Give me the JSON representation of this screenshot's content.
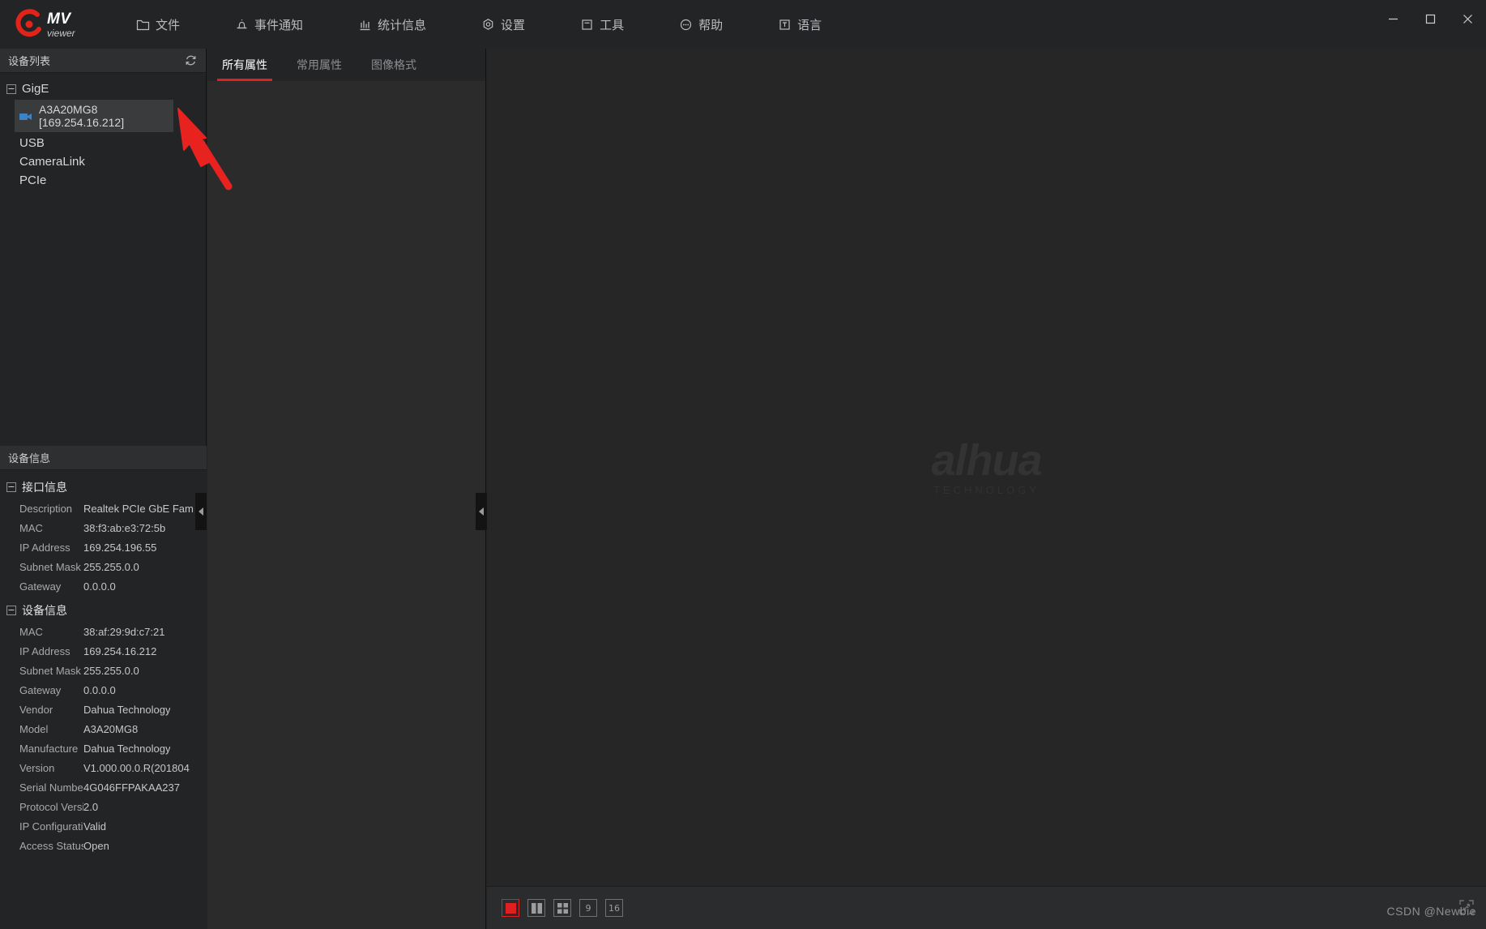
{
  "app": {
    "logo_primary": "MV",
    "logo_secondary": "viewer",
    "accent_color": "#e02020",
    "background_color": "#232425"
  },
  "menu": {
    "items": [
      {
        "label": "文件",
        "icon": "folder-icon"
      },
      {
        "label": "事件通知",
        "icon": "bell-icon"
      },
      {
        "label": "统计信息",
        "icon": "bar-chart-icon"
      },
      {
        "label": "设置",
        "icon": "gear-icon"
      },
      {
        "label": "工具",
        "icon": "toolbox-icon"
      },
      {
        "label": "帮助",
        "icon": "help-icon"
      },
      {
        "label": "语言",
        "icon": "language-icon"
      }
    ]
  },
  "window_controls": {
    "minimize": "—",
    "maximize": "□",
    "close": "✕"
  },
  "sidebar": {
    "title": "设备列表",
    "refresh_icon": "refresh-icon",
    "tree": {
      "group_label": "GigE",
      "group_expander": "−",
      "devices": [
        {
          "label": "A3A20MG8 [169.254.16.212]",
          "selected": true,
          "icon": "camera-icon"
        }
      ],
      "nodes": [
        "USB",
        "CameraLink",
        "PCIe"
      ]
    }
  },
  "device_info": {
    "title": "设备信息",
    "sections": [
      {
        "name": "接口信息",
        "expander": "−",
        "rows": [
          {
            "key": "Description",
            "value": "Realtek PCIe GbE Fam"
          },
          {
            "key": "MAC",
            "value": "38:f3:ab:e3:72:5b"
          },
          {
            "key": "IP Address",
            "value": "169.254.196.55"
          },
          {
            "key": "Subnet Mask",
            "value": "255.255.0.0"
          },
          {
            "key": "Gateway",
            "value": "0.0.0.0"
          }
        ]
      },
      {
        "name": "设备信息",
        "expander": "−",
        "rows": [
          {
            "key": "MAC",
            "value": "38:af:29:9d:c7:21"
          },
          {
            "key": "IP Address",
            "value": "169.254.16.212"
          },
          {
            "key": "Subnet Mask",
            "value": "255.255.0.0"
          },
          {
            "key": "Gateway",
            "value": "0.0.0.0"
          },
          {
            "key": "Vendor",
            "value": "Dahua Technology"
          },
          {
            "key": "Model",
            "value": "A3A20MG8"
          },
          {
            "key": "Manufacture",
            "value": "Dahua Technology"
          },
          {
            "key": "Version",
            "value": "V1.000.00.0.R(201804"
          },
          {
            "key": "Serial Number",
            "value": "4G046FFPAKAA237"
          },
          {
            "key": "Protocol Version",
            "value": "2.0"
          },
          {
            "key": "IP Configuration",
            "value": "Valid"
          },
          {
            "key": "Access Status",
            "value": "Open"
          }
        ]
      }
    ]
  },
  "properties": {
    "tabs": [
      {
        "label": "所有属性",
        "active": true
      },
      {
        "label": "常用属性",
        "active": false
      },
      {
        "label": "图像格式",
        "active": false
      }
    ]
  },
  "view": {
    "watermark_word": "alhua",
    "watermark_sub": "TECHNOLOGY",
    "layout_buttons": [
      {
        "name": "layout-1",
        "label": "",
        "active": true
      },
      {
        "name": "layout-2",
        "label": "",
        "active": false
      },
      {
        "name": "layout-4",
        "label": "",
        "active": false
      },
      {
        "name": "layout-9",
        "label": "9",
        "active": false
      },
      {
        "name": "layout-16",
        "label": "16",
        "active": false
      }
    ],
    "overlay_credit": "CSDN @Newbie"
  }
}
